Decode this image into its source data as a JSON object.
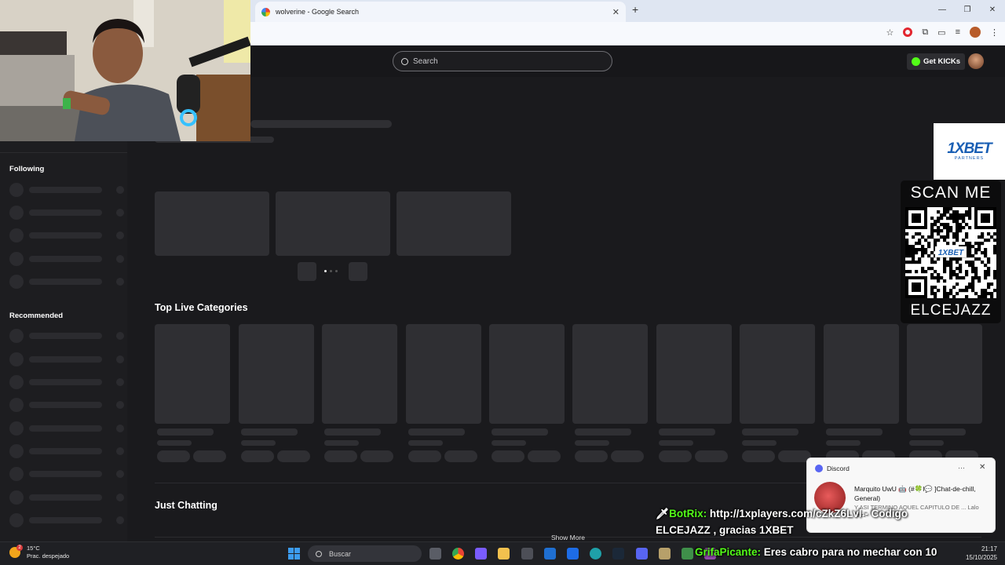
{
  "browser": {
    "tab_title": "wolverine - Google Search",
    "tab_close": "✕",
    "new_tab": "+",
    "window_controls": [
      "—",
      "❐",
      "✕"
    ]
  },
  "kick": {
    "search_placeholder": "Search",
    "get_kicks": "Get KICKs",
    "sidebar": {
      "following_title": "Following",
      "recommended_title": "Recommended"
    },
    "sections": {
      "top_live_categories": "Top Live Categories",
      "just_chatting": "Just Chatting",
      "show_more": "Show More"
    }
  },
  "sponsor": {
    "logo": "1XBET",
    "sub": "PARTNERS",
    "scan_me": "SCAN ME",
    "code": "ELCEJAZZ",
    "qr_center": "1XBET"
  },
  "discord_toast": {
    "app": "Discord",
    "more": "···",
    "close": "✕",
    "author": "Marquito UwU",
    "channel": "🤖 (#🍀l💬 ]Chat-de-chill, General)",
    "preview": "Y ASI TERMINO AQUEL CAPITULO DE ... Lalo Jazz"
  },
  "overlay_chat": {
    "line1_user": "BotRix:",
    "line1_text": " http://1xplayers.com/cZkZ6Lvl - Codigo",
    "line2_text": "ELCEJAZZ , gracias 1XBET",
    "line3_user": "GrifaPicante:",
    "line3_text": " Eres cabro para no mechar con 10"
  },
  "taskbar": {
    "weather_temp": "15°C",
    "weather_desc": "Prac. despejado",
    "weather_badge": "2",
    "search_label": "Buscar",
    "time": "21:17",
    "date": "15/10/2025"
  },
  "colors": {
    "kick_green": "#53fc18",
    "page_bg": "#1a1a1d",
    "skeleton": "#2f2f33",
    "xbet_blue": "#1a5fb4"
  }
}
